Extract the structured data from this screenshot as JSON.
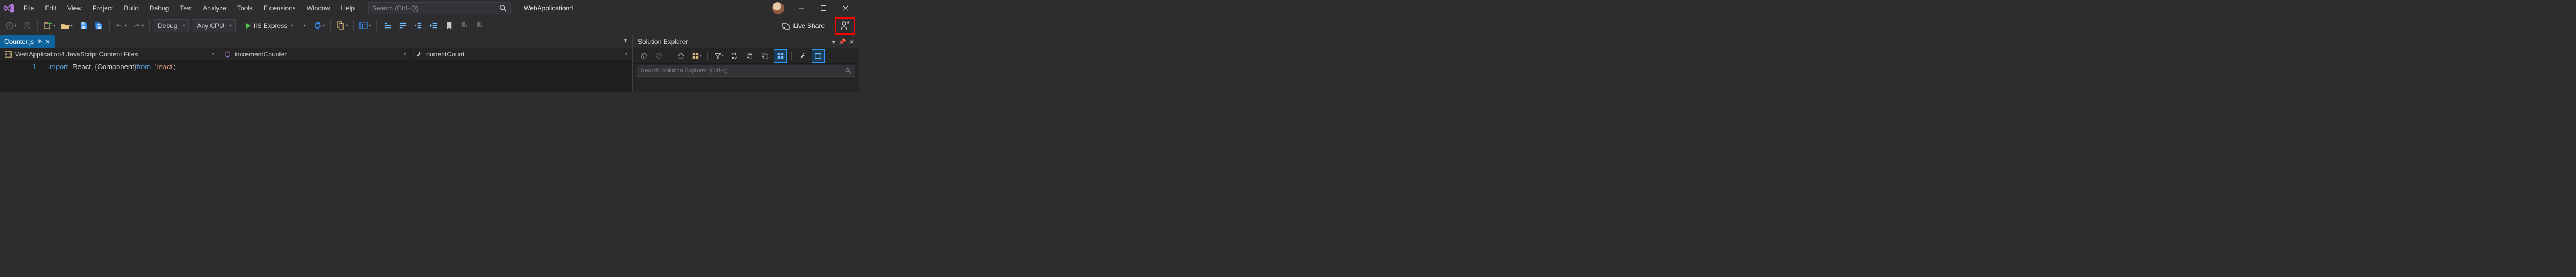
{
  "menu": [
    "File",
    "Edit",
    "View",
    "Project",
    "Build",
    "Debug",
    "Test",
    "Analyze",
    "Tools",
    "Extensions",
    "Window",
    "Help"
  ],
  "search": {
    "placeholder": "Search (Ctrl+Q)"
  },
  "appTitle": "WebApplication4",
  "toolbar": {
    "configCombo": "Debug",
    "platformCombo": "Any CPU",
    "runTarget": "IIS Express",
    "liveShare": "Live Share"
  },
  "tab": {
    "name": "Counter.js"
  },
  "navbar": {
    "scope": "WebApplication4 JavaScript Content Files",
    "member": "incrementCounter",
    "field": "currentCount"
  },
  "code": {
    "lineNumber": "1",
    "k_import": "import",
    "id_react": "React",
    "p_comma": ", { ",
    "id_component": "Component",
    "p_close": " } ",
    "k_from": "from",
    "str_react": "'react'",
    "p_semi": ";"
  },
  "solutionExplorer": {
    "title": "Solution Explorer",
    "searchPlaceholder": "Search Solution Explorer (Ctrl+;)"
  }
}
